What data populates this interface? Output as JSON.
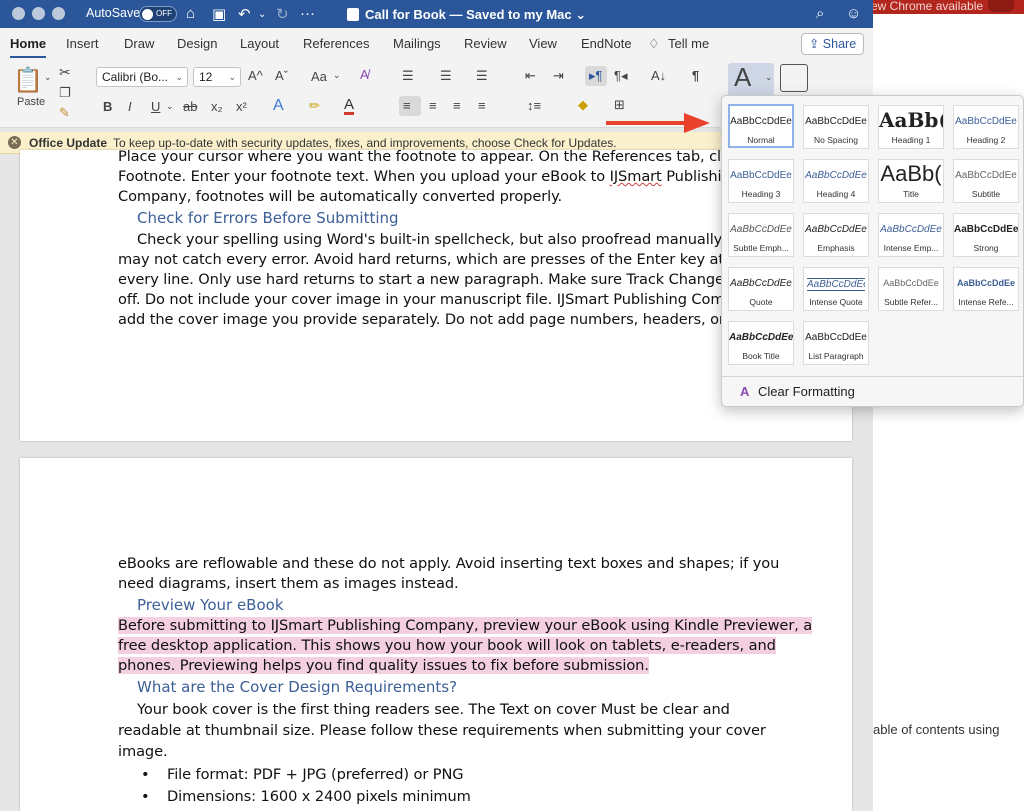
{
  "window": {
    "autosave_label": "AutoSave",
    "autosave_state": "OFF",
    "doc_title": "Call for Book — Saved to my Mac",
    "doc_title_caret": "⌄"
  },
  "background": {
    "chrome_text": "ew Chrome available",
    "toc_text": "able of contents using"
  },
  "tabs": [
    "Home",
    "Insert",
    "Draw",
    "Design",
    "Layout",
    "References",
    "Mailings",
    "Review",
    "View",
    "EndNote",
    "Tell me"
  ],
  "share_label": "Share",
  "ribbon": {
    "paste_label": "Paste",
    "font_name": "Calibri (Bo...",
    "font_size": "12",
    "bold": "B",
    "italic": "I",
    "underline": "U",
    "strike": "ab",
    "subscript": "x₂",
    "superscript": "x²",
    "grow": "A^",
    "shrink": "Aˇ",
    "case": "Aa",
    "pilcrow": "¶"
  },
  "update_bar": {
    "title": "Office Update",
    "message": "To keep up-to-date with security updates, fixes, and improvements, choose Check for Updates."
  },
  "page1": {
    "lines": [
      "Place your cursor where you want the footnote to appear. On the References tab, click Insert",
      "Footnote. Enter your footnote text. When you upload your eBook to ",
      "Company, footnotes will be automatically converted properly."
    ],
    "brand": "IJSmart",
    "brand_suffix": " Publishing",
    "heading": "Check for Errors Before Submitting",
    "para": [
      "Check your spelling using Word's built-in spellcheck, but also proofread manually as tools",
      "may not catch every error. Avoid hard returns, which are presses of the Enter key at the end of",
      "every line. Only use hard returns to start a new paragraph. Make sure Track Changes is turned",
      "off. Do not include your cover image in your manuscript file. IJSmart Publishing Company will",
      "add the cover image you provide separately. Do not add page numbers, headers, or footers, as"
    ]
  },
  "page2": {
    "lines_top": [
      "eBooks are reflowable and these do not apply. Avoid inserting text boxes and shapes; if you",
      "need diagrams, insert them as images instead."
    ],
    "heading1": "Preview Your eBook",
    "highlighted": [
      "Before submitting to IJSmart Publishing Company, preview your eBook using Kindle Previewer, a",
      "free desktop application. This shows you how your book will look on tablets, e-readers, and",
      "phones. Previewing helps you find quality issues to fix before submission. "
    ],
    "heading2": "What are the Cover Design Requirements?",
    "para": [
      "Your book cover is the first thing readers see. The Text on cover Must be clear and",
      "readable at thumbnail size. Please follow these requirements when submitting your cover",
      "image."
    ],
    "bullets": [
      "File format: PDF + JPG (preferred) or PNG",
      "Dimensions: 1600 x 2400 pixels minimum"
    ]
  },
  "styles_gallery": {
    "sample": "AaBbCcDdEe",
    "styles": [
      {
        "name": "Normal",
        "sample": "AaBbCcDdEe"
      },
      {
        "name": "No Spacing",
        "sample": "AaBbCcDdEe"
      },
      {
        "name": "Heading 1",
        "sample": "AaBb("
      },
      {
        "name": "Heading 2",
        "sample": "AaBbCcDdEe"
      },
      {
        "name": "Heading 3",
        "sample": "AaBbCcDdEe"
      },
      {
        "name": "Heading 4",
        "sample": "AaBbCcDdEe"
      },
      {
        "name": "Title",
        "sample": "AaBb("
      },
      {
        "name": "Subtitle",
        "sample": "AaBbCcDdEe"
      },
      {
        "name": "Subtle Emph...",
        "sample": "AaBbCcDdEe"
      },
      {
        "name": "Emphasis",
        "sample": "AaBbCcDdEe"
      },
      {
        "name": "Intense Emp...",
        "sample": "AaBbCcDdEe"
      },
      {
        "name": "Strong",
        "sample": "AaBbCcDdEe"
      },
      {
        "name": "Quote",
        "sample": "AaBbCcDdEe"
      },
      {
        "name": "Intense Quote",
        "sample": "AaBbCcDdEe"
      },
      {
        "name": "Subtle Refer...",
        "sample": "AaBbCcDdEe"
      },
      {
        "name": "Intense Refe...",
        "sample": "AaBbCcDdEe"
      },
      {
        "name": "Book Title",
        "sample": "AaBbCcDdEe"
      },
      {
        "name": "List Paragraph",
        "sample": "AaBbCcDdEe"
      }
    ],
    "clear_formatting": "Clear Formatting"
  },
  "colors": {
    "title_bar": "#2b579a",
    "highlight": "#f4cfe2",
    "heading_text": "#3b5f96",
    "arrow": "#e8412c"
  }
}
